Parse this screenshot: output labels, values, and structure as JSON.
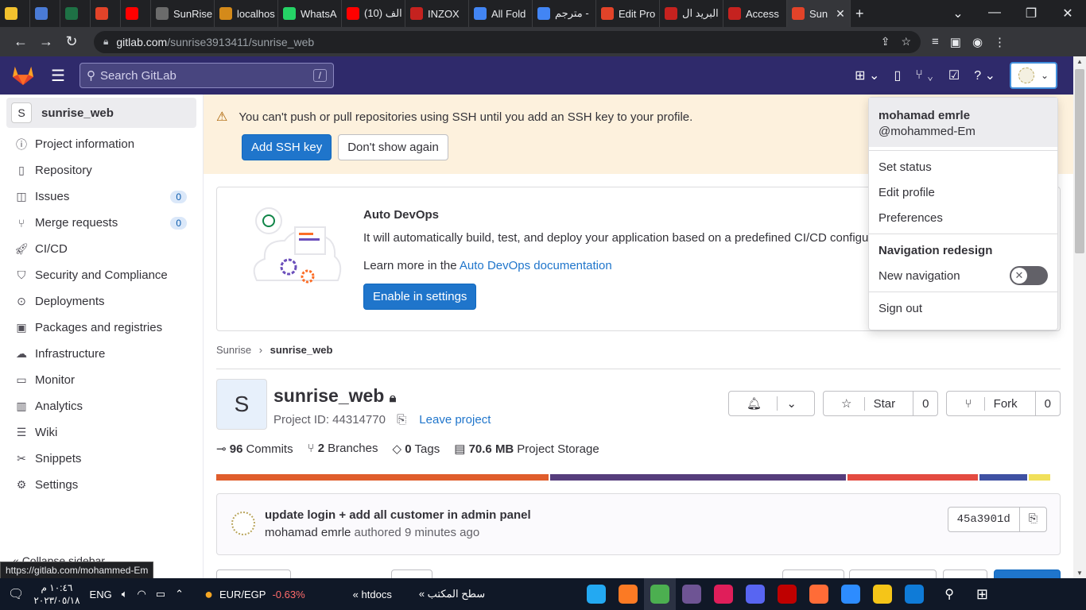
{
  "browser": {
    "tabs": [
      {
        "label": "",
        "color": "#f2c12e"
      },
      {
        "label": "",
        "color": "#4a7bd6"
      },
      {
        "label": "",
        "color": "#1e7145"
      },
      {
        "label": "",
        "color": "#e24329"
      },
      {
        "label": "",
        "color": "#ff0000"
      },
      {
        "label": "SunRise",
        "color": "#6b6b6b"
      },
      {
        "label": "localhos",
        "color": "#d48a1a"
      },
      {
        "label": "WhatsA",
        "color": "#25d366"
      },
      {
        "label": "(10) الف",
        "color": "#ff0000"
      },
      {
        "label": "INZOX",
        "color": "#c5221f"
      },
      {
        "label": "All Fold",
        "color": "#4285f4"
      },
      {
        "label": "مترجم -",
        "color": "#4285f4"
      },
      {
        "label": "Edit Pro",
        "color": "#e24329"
      },
      {
        "label": "البريد ال",
        "color": "#c5221f"
      },
      {
        "label": "Access",
        "color": "#c5221f"
      },
      {
        "label": "Sun",
        "color": "#e24329",
        "active": true
      }
    ],
    "url_domain": "gitlab.com",
    "url_path": "/sunrise3913411/sunrise_web",
    "status_url": "https://gitlab.com/mohammed-Em"
  },
  "gitlab": {
    "search_placeholder": "Search GitLab",
    "search_shortcut": "/",
    "project_badge": "S",
    "project_name": "sunrise_web",
    "sidebar": [
      {
        "label": "Project information",
        "icon": "info-icon"
      },
      {
        "label": "Repository",
        "icon": "doc-icon"
      },
      {
        "label": "Issues",
        "icon": "issues-icon",
        "count": "0"
      },
      {
        "label": "Merge requests",
        "icon": "merge-icon",
        "count": "0"
      },
      {
        "label": "CI/CD",
        "icon": "rocket-icon"
      },
      {
        "label": "Security and Compliance",
        "icon": "shield-icon"
      },
      {
        "label": "Deployments",
        "icon": "deploy-icon"
      },
      {
        "label": "Packages and registries",
        "icon": "package-icon"
      },
      {
        "label": "Infrastructure",
        "icon": "cloud-icon"
      },
      {
        "label": "Monitor",
        "icon": "monitor-icon"
      },
      {
        "label": "Analytics",
        "icon": "chart-icon"
      },
      {
        "label": "Wiki",
        "icon": "book-icon"
      },
      {
        "label": "Snippets",
        "icon": "scissors-icon"
      },
      {
        "label": "Settings",
        "icon": "gear-icon"
      }
    ],
    "collapse_label": "Collapse sidebar",
    "alert": {
      "message": "You can't push or pull repositories using SSH until you add an SSH key to your profile.",
      "primary": "Add SSH key",
      "secondary": "Don't show again"
    },
    "devops": {
      "title": "Auto DevOps",
      "desc": "It will automatically build, test, and deploy your application based on a predefined CI/CD configu",
      "learn_prefix": "Learn more in the ",
      "learn_link": "Auto DevOps documentation",
      "button": "Enable in settings"
    },
    "breadcrumb": {
      "parent": "Sunrise",
      "current": "sunrise_web"
    },
    "project": {
      "avatar": "S",
      "title": "sunrise_web",
      "id_label": "Project ID: 44314770",
      "leave": "Leave project",
      "star_label": "Star",
      "star_count": "0",
      "fork_label": "Fork",
      "fork_count": "0"
    },
    "stats": {
      "commits_n": "96",
      "commits_l": "Commits",
      "branches_n": "2",
      "branches_l": "Branches",
      "tags_n": "0",
      "tags_l": "Tags",
      "storage_n": "70.6 MB",
      "storage_l": "Project Storage"
    },
    "languages": [
      {
        "share": 0.4,
        "color": "#e05d2c"
      },
      {
        "share": 0.355,
        "color": "#563d7c"
      },
      {
        "share": 0.157,
        "color": "#e44b41"
      },
      {
        "share": 0.057,
        "color": "#3f51a3"
      },
      {
        "share": 0.026,
        "color": "#f1e05a"
      }
    ],
    "commit": {
      "title": "update login + add all customer in admin panel",
      "author": "mohamad emrle",
      "time": " authored 9 minutes ago",
      "sha": "45a3901d"
    },
    "user_menu": {
      "name": "mohamad emrle",
      "handle": "@mohammed-Em",
      "items": [
        "Set status",
        "Edit profile",
        "Preferences"
      ],
      "nav_heading": "Navigation redesign",
      "nav_toggle": "New navigation",
      "signout": "Sign out"
    }
  },
  "taskbar": {
    "time": "١٠:٤٦ م",
    "date": "٢٠٢٣/٠٥/١٨",
    "lang": "ENG",
    "ticker": "EUR/EGP",
    "ticker_change": "-0.63%",
    "folder1": "htdocs",
    "folder2": "سطح المكتب",
    "apps": [
      {
        "name": "vscode",
        "color": "#23a9f2"
      },
      {
        "name": "xampp",
        "color": "#fb7a24"
      },
      {
        "name": "chrome",
        "color": "#4caf50"
      },
      {
        "name": "github",
        "color": "#6e5494"
      },
      {
        "name": "slack",
        "color": "#e01e5a"
      },
      {
        "name": "discord",
        "color": "#5865f2"
      },
      {
        "name": "filezilla",
        "color": "#bf0000"
      },
      {
        "name": "postman",
        "color": "#ff6c37"
      },
      {
        "name": "zoom",
        "color": "#2d8cff"
      },
      {
        "name": "explorer",
        "color": "#f5c518"
      },
      {
        "name": "edge",
        "color": "#0f7bd7"
      }
    ]
  }
}
